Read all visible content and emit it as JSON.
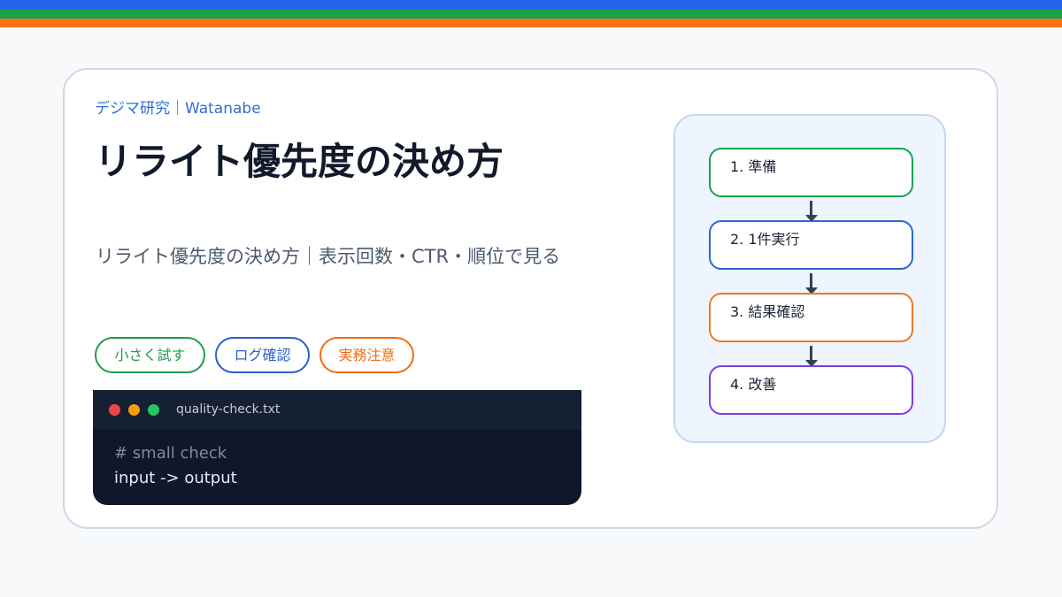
{
  "colors": {
    "blue": "#2563eb",
    "green": "#16a34a",
    "orange": "#f97316",
    "purple": "#7e3ee0"
  },
  "header": {
    "brand": "デジマ研究｜Watanabe",
    "title": "リライト優先度の決め方",
    "subtitle": "リライト優先度の決め方｜表示回数・CTR・順位で見る"
  },
  "tags": [
    {
      "label": "小さく試す",
      "color": "#1f9d4c"
    },
    {
      "label": "ログ確認",
      "color": "#2b5fcf"
    },
    {
      "label": "実務注意",
      "color": "#f06d14"
    }
  ],
  "code": {
    "filename": "quality-check.txt",
    "lines": [
      "# small check",
      "input -> output"
    ],
    "window_dots": [
      "#ef4444",
      "#f59e0b",
      "#22c55e"
    ]
  },
  "flow": {
    "steps": [
      {
        "label": "1. 準備",
        "color": "#1aa150"
      },
      {
        "label": "2. 1件実行",
        "color": "#2a66d8"
      },
      {
        "label": "3. 結果確認",
        "color": "#ee7a22"
      },
      {
        "label": "4. 改善",
        "color": "#7e3ee0"
      }
    ]
  }
}
